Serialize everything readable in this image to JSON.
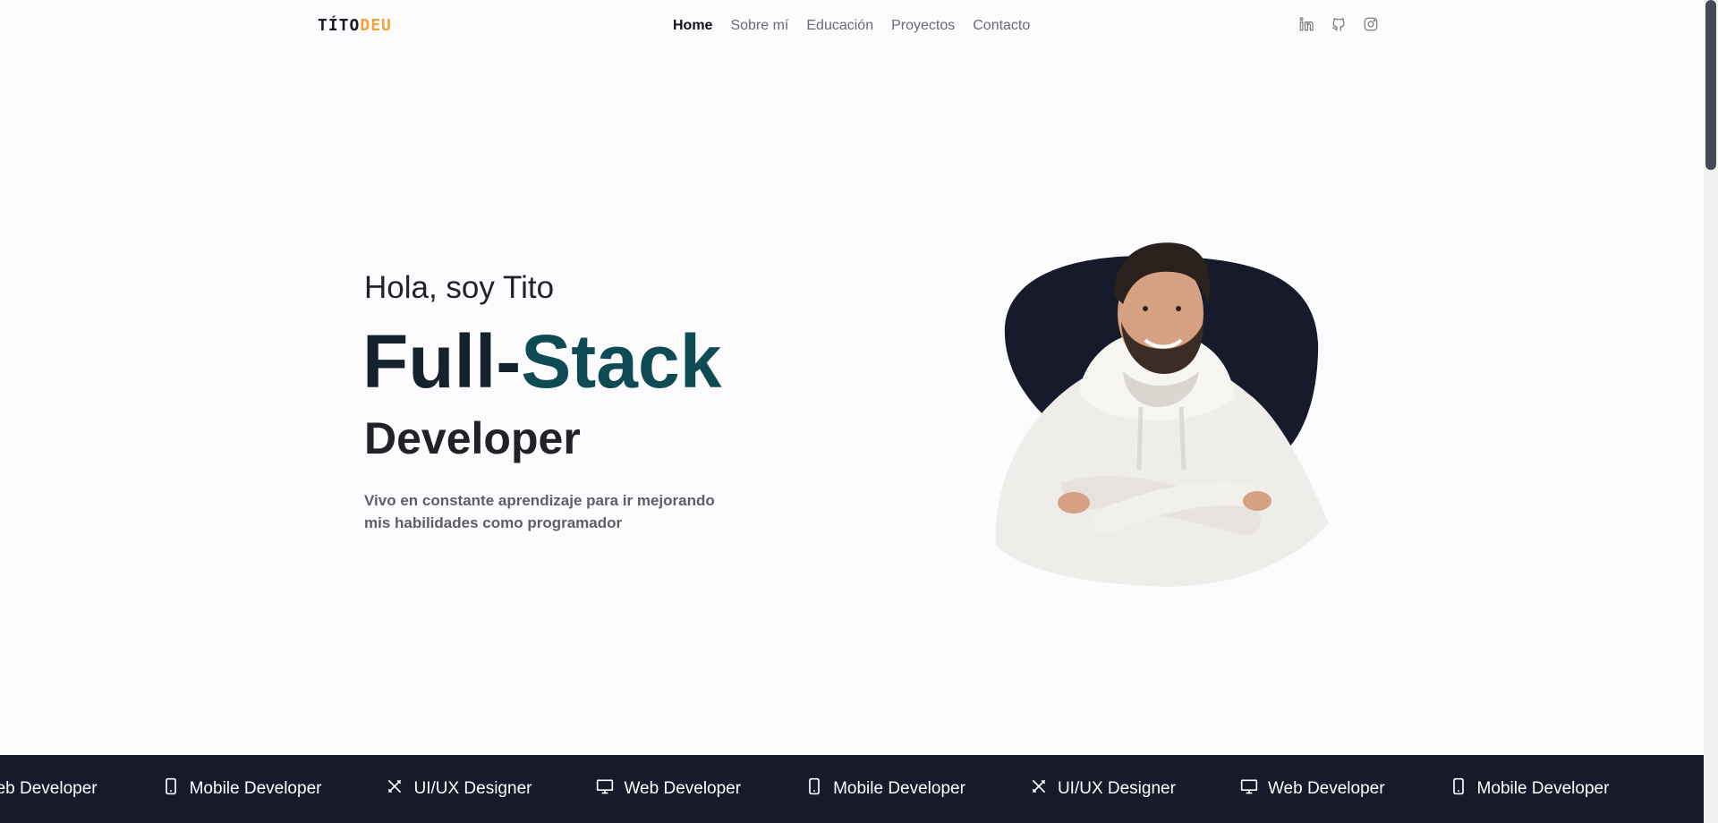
{
  "header": {
    "logo_part1": "TÍTO",
    "logo_part2": "DEU",
    "nav": [
      {
        "label": "Home",
        "active": true
      },
      {
        "label": "Sobre mí",
        "active": false
      },
      {
        "label": "Educación",
        "active": false
      },
      {
        "label": "Proyectos",
        "active": false
      },
      {
        "label": "Contacto",
        "active": false
      }
    ],
    "socials": [
      "linkedin-icon",
      "github-icon",
      "instagram-icon"
    ]
  },
  "hero": {
    "greeting": "Hola, soy Tito",
    "role_word1": "Full-",
    "role_word2": "Stack",
    "role_word3": "Developer",
    "tagline": "Vivo en constante aprendizaje para ir mejorando mis habilidades como programador"
  },
  "band": {
    "items": [
      {
        "label": "Web Developer",
        "icon": "monitor-icon"
      },
      {
        "label": "Mobile Developer",
        "icon": "smartphone-icon"
      },
      {
        "label": "UI/UX Designer",
        "icon": "design-tools-icon"
      },
      {
        "label": "Web Developer",
        "icon": "monitor-icon"
      },
      {
        "label": "Mobile Developer",
        "icon": "smartphone-icon"
      },
      {
        "label": "UI/UX Designer",
        "icon": "design-tools-icon"
      },
      {
        "label": "Web Developer",
        "icon": "monitor-icon"
      },
      {
        "label": "Mobile Developer",
        "icon": "smartphone-icon"
      }
    ]
  },
  "colors": {
    "accent": "#f0a23b",
    "teal": "#0f4b55",
    "dark": "#161a2a"
  }
}
